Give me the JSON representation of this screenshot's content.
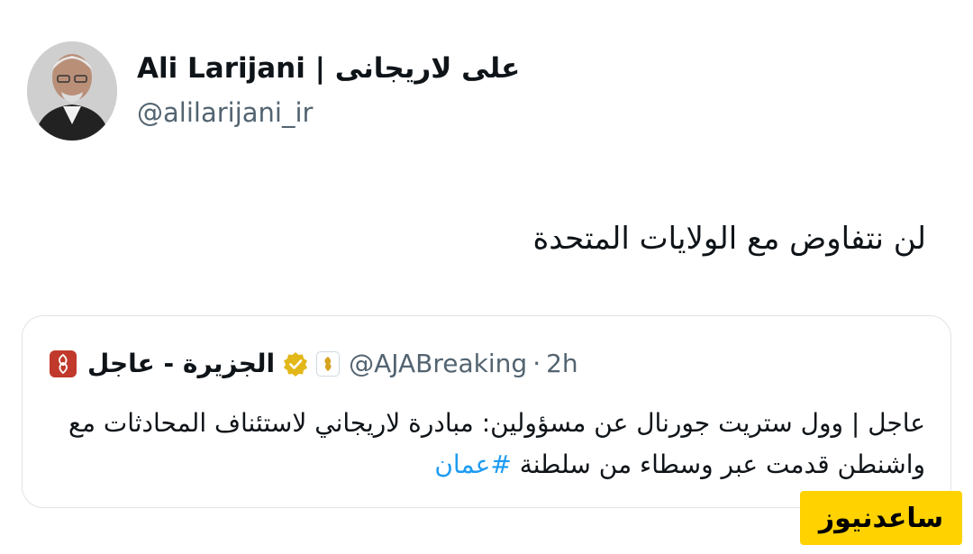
{
  "author": {
    "name": "Ali Larijani | علی لاریجانی",
    "handle": "@alilarijani_ir",
    "avatar_icon": "profile-photo"
  },
  "tweet": {
    "text": "لن نتفاوض مع الولايات المتحدة"
  },
  "quoted_tweet": {
    "name": "الجزيرة - عاجل",
    "handle": "@AJABreaking",
    "separator": "·",
    "time": "2h",
    "text_main": "عاجل | وول ستريت جورنال عن مسؤولين: مبادرة لاريجاني لاستئناف المحادثات مع واشنطن قدمت عبر وسطاء من سلطنة",
    "hashtag": "#عمان",
    "logo_icon": "aljazeera-logo",
    "verified_icon": "gold-verified-badge",
    "affiliate_icon": "aljazeera-affiliate-badge",
    "logo_color": "#c0392b",
    "verified_color": "#e2b719"
  },
  "watermark": {
    "text": "ساعدنیوز",
    "color": "#ffd200"
  },
  "colors": {
    "text": "#0f1419",
    "secondary": "#536471",
    "link": "#1d9bf0",
    "border": "#dfe3e7"
  }
}
